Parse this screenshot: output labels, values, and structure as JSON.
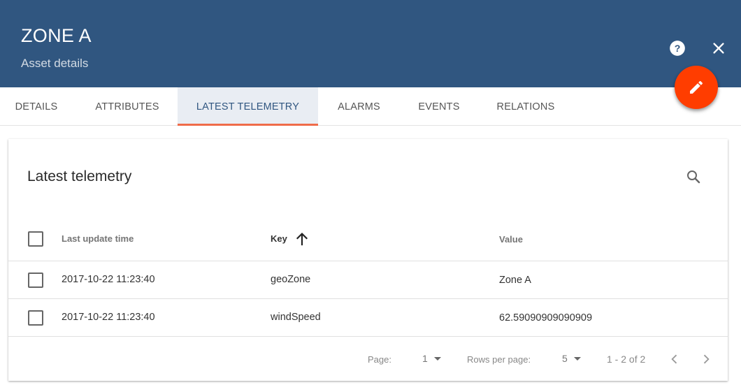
{
  "header": {
    "title": "ZONE A",
    "subtitle": "Asset details",
    "help_icon": "help-circle-icon",
    "close_icon": "close-icon",
    "edit_icon": "pencil-icon"
  },
  "tabs": [
    {
      "label": "DETAILS",
      "active": false
    },
    {
      "label": "ATTRIBUTES",
      "active": false
    },
    {
      "label": "LATEST TELEMETRY",
      "active": true
    },
    {
      "label": "ALARMS",
      "active": false
    },
    {
      "label": "EVENTS",
      "active": false
    },
    {
      "label": "RELATIONS",
      "active": false
    }
  ],
  "card": {
    "title": "Latest telemetry",
    "search_icon": "search-icon"
  },
  "table": {
    "columns": {
      "last_update_time": "Last update time",
      "key": "Key",
      "value": "Value"
    },
    "sort": {
      "column": "key",
      "direction": "ascending",
      "icon": "arrow-up-icon"
    },
    "rows": [
      {
        "last_update_time": "2017-10-22 11:23:40",
        "key": "geoZone",
        "value": "Zone A",
        "checked": false
      },
      {
        "last_update_time": "2017-10-22 11:23:40",
        "key": "windSpeed",
        "value": "62.59090909090909",
        "checked": false
      }
    ]
  },
  "pagination": {
    "page_label": "Page:",
    "page_value": "1",
    "rows_label": "Rows per page:",
    "rows_value": "5",
    "range": "1 - 2 of 2",
    "prev_icon": "chevron-left-icon",
    "next_icon": "chevron-right-icon"
  },
  "colors": {
    "header_bg": "#305680",
    "fab_bg": "#ff3d00",
    "tab_indicator": "#ef6c4a",
    "active_tab_bg": "#e9edf3"
  }
}
